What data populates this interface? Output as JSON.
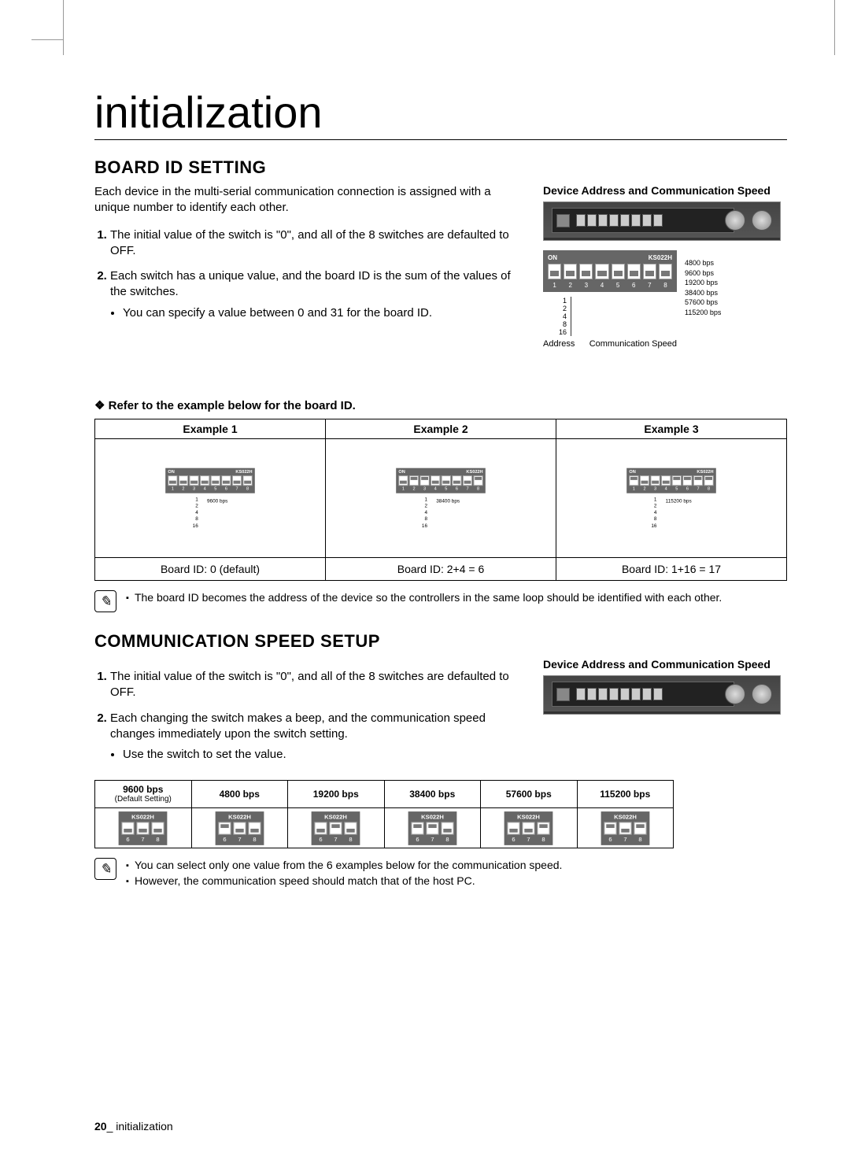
{
  "chapter_title": "initialization",
  "section1": {
    "heading": "BOARD ID SETTING",
    "intro": "Each device in the multi-serial communication connection is assigned with a unique number to identify each other.",
    "steps": [
      "The initial value of the switch is \"0\", and all of the 8 switches are defaulted to OFF.",
      "Each switch has a unique value, and the board ID is the sum of the values of the switches."
    ],
    "step2_bullet": "You can specify a value between 0 and 31 for the board ID.",
    "right_caption": "Device Address and Communication Speed",
    "dip": {
      "label_on": "ON",
      "label_model": "KS022H",
      "switch_numbers": [
        "1",
        "2",
        "3",
        "4",
        "5",
        "6",
        "7",
        "8"
      ],
      "address_values": [
        "1",
        "2",
        "4",
        "8",
        "16"
      ],
      "speeds": [
        "4800 bps",
        "9600 bps",
        "19200 bps",
        "38400 bps",
        "57600 bps",
        "115200 bps"
      ],
      "sub_left": "Address",
      "sub_right": "Communication Speed"
    },
    "refer_line": "Refer to the example below for the board ID.",
    "examples": {
      "headers": [
        "Example 1",
        "Example 2",
        "Example 3"
      ],
      "model": "KS022H",
      "on_label": "ON",
      "addr_values": [
        "1",
        "2",
        "4",
        "8",
        "16"
      ],
      "speeds": [
        "9600 bps",
        "38400 bps",
        "115200 bps"
      ],
      "footers": [
        "Board ID: 0 (default)",
        "Board ID: 2+4 = 6",
        "Board ID: 1+16 = 17"
      ],
      "switch_states": [
        [
          false,
          false,
          false,
          false,
          false,
          false,
          false,
          false
        ],
        [
          false,
          true,
          true,
          false,
          false,
          false,
          false,
          true
        ],
        [
          true,
          false,
          false,
          false,
          true,
          true,
          true,
          true
        ]
      ]
    },
    "note": "The board ID becomes the address of the device so the controllers in the same loop should be identified with each other."
  },
  "section2": {
    "heading": "COMMUNICATION SPEED SETUP",
    "steps": [
      "The initial value of the switch is \"0\", and all of the 8 switches are defaulted to OFF.",
      "Each changing the switch makes a beep, and the communication speed changes immediately upon the switch setting."
    ],
    "step2_bullet": "Use the switch to set the value.",
    "right_caption": "Device Address and Communication Speed",
    "speeds_table": {
      "headers": [
        {
          "line1": "9600 bps",
          "line2": "(Default Setting)"
        },
        {
          "line1": "4800 bps",
          "line2": ""
        },
        {
          "line1": "19200 bps",
          "line2": ""
        },
        {
          "line1": "38400 bps",
          "line2": ""
        },
        {
          "line1": "57600 bps",
          "line2": ""
        },
        {
          "line1": "115200 bps",
          "line2": ""
        }
      ],
      "model": "KS022H",
      "switch_numbers": [
        "6",
        "7",
        "8"
      ],
      "switch_states": [
        [
          false,
          false,
          false
        ],
        [
          true,
          false,
          false
        ],
        [
          false,
          true,
          false
        ],
        [
          true,
          true,
          false
        ],
        [
          false,
          false,
          true
        ],
        [
          true,
          false,
          true
        ]
      ]
    },
    "notes": [
      "You can select only one value from the 6 examples below for the communication speed.",
      "However, the communication speed should match that of the host PC."
    ]
  },
  "footer": {
    "page_number": "20",
    "separator": "_",
    "text": "initialization"
  }
}
